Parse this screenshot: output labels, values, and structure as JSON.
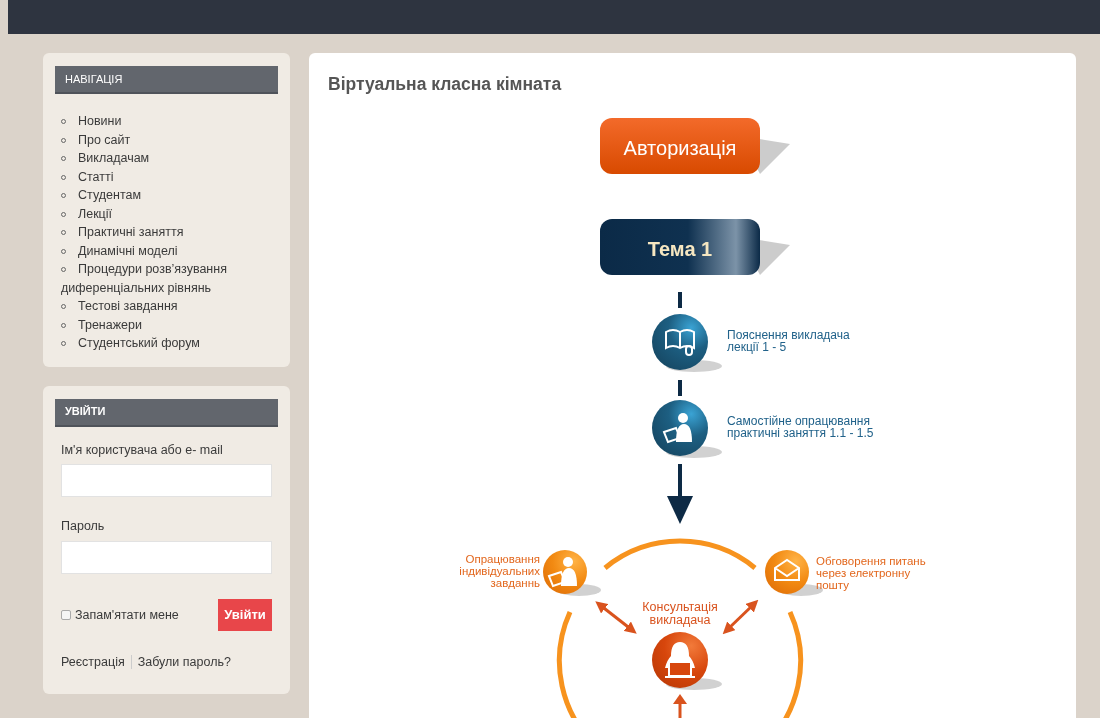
{
  "navigation": {
    "title": "НАВІГАЦІЯ",
    "items": [
      "Новини",
      "Про сайт",
      "Викладачам",
      "Статті",
      "Студентам",
      "Лекції",
      "Практичні заняття",
      "Динамічні моделі",
      "Процедури розв’язування диференціальних рівнянь",
      "Тестові завдання",
      "Тренажери",
      "Студентський форум"
    ]
  },
  "login": {
    "title": "УВІЙТИ",
    "username_label": "Ім'я користувача або e- mail",
    "password_label": "Пароль",
    "remember": {
      "label": "Запам'ятати мене",
      "checked": false
    },
    "submit": "Увійти",
    "links": [
      "Реєстрація",
      "Забули пароль?"
    ]
  },
  "main": {
    "title": "Віртуальна класна кімната",
    "blocks": [
      {
        "kind": "orange",
        "label": "Авторизація"
      },
      {
        "kind": "navy",
        "label": "Тема 1"
      }
    ],
    "steps": [
      {
        "kind": "book",
        "text": "Пояснення викладача\nлекції 1 - 5"
      },
      {
        "kind": "reader",
        "text": "Самостійне опрацювання\nпрактичні заняття 1.1 - 1.5"
      }
    ],
    "cycle": [
      {
        "kind": "reader",
        "text": "Опрацювання\nіндивідуальних\nзавданнь"
      },
      {
        "kind": "mail",
        "text": "Обговорення питань\nчерез електронну\nпошту"
      },
      {
        "kind": "teacher",
        "text": "Консультація\nвикладача"
      }
    ]
  }
}
